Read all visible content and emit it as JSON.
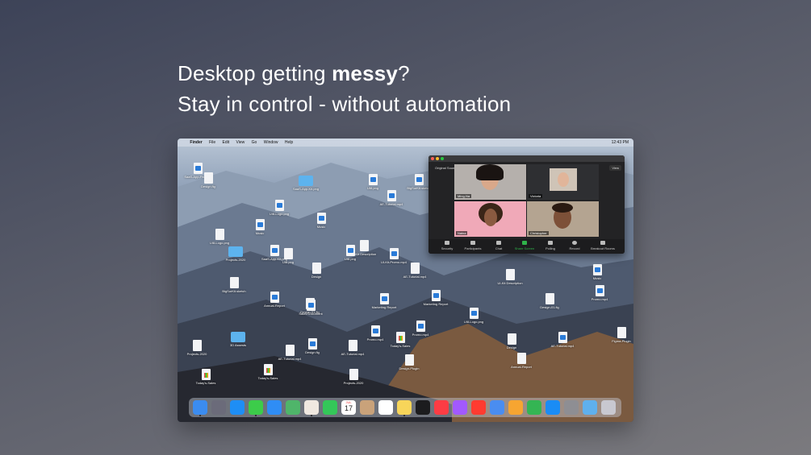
{
  "headline": {
    "line1_prefix": "Desktop getting ",
    "line1_bold": "messy",
    "line1_suffix": "?",
    "line2": "Stay in control - without automation"
  },
  "menubar": {
    "apple": "",
    "app": "Finder",
    "items": [
      "File",
      "Edit",
      "View",
      "Go",
      "Window",
      "Help"
    ],
    "clock": "12:43 PM"
  },
  "desktop_files": [
    {
      "label": "SaaS-App-Feature",
      "kind": "doc-blue"
    },
    {
      "label": "Design.fig",
      "kind": "doc"
    },
    {
      "label": "SaaS-App-Kit.png",
      "kind": "folder"
    },
    {
      "label": "UI8.png",
      "kind": "doc-blue"
    },
    {
      "label": "AE-Tutorial.mp4",
      "kind": "doc-blue"
    },
    {
      "label": "BigSurKit.sketch",
      "kind": "doc-blue"
    },
    {
      "label": "UI8-Logo.png",
      "kind": "doc-blue"
    },
    {
      "label": "Music",
      "kind": "doc-blue"
    },
    {
      "label": "Music",
      "kind": "doc-blue"
    },
    {
      "label": "UI8-Logo.png",
      "kind": "doc"
    },
    {
      "label": "Projects-2020",
      "kind": "folder"
    },
    {
      "label": "SaaS-App-Kit.png",
      "kind": "doc-blue"
    },
    {
      "label": "UI8.png",
      "kind": "doc"
    },
    {
      "label": "Lt-Kit Description",
      "kind": "doc"
    },
    {
      "label": "UI8.png",
      "kind": "doc-blue"
    },
    {
      "label": "UI-Kit-Promo.mp4",
      "kind": "doc-blue"
    },
    {
      "label": "Design",
      "kind": "doc"
    },
    {
      "label": "AE-Tutorial.mp4",
      "kind": "doc"
    },
    {
      "label": "UI-Kit Description",
      "kind": "doc"
    },
    {
      "label": "Music",
      "kind": "doc-blue"
    },
    {
      "label": "BigSurKit.sketch",
      "kind": "doc"
    },
    {
      "label": "Annual-Report",
      "kind": "doc-blue"
    },
    {
      "label": "Design-01.fig",
      "kind": "doc"
    },
    {
      "label": "Sales Document",
      "kind": "doc-blue"
    },
    {
      "label": "Marketing Report",
      "kind": "doc-blue"
    },
    {
      "label": "Marketing Report",
      "kind": "doc-blue"
    },
    {
      "label": "Design-01.fig",
      "kind": "doc"
    },
    {
      "label": "Promo.mp4",
      "kind": "doc-blue"
    },
    {
      "label": "UI8-Logo.png",
      "kind": "doc-blue"
    },
    {
      "label": "Promo.mp4",
      "kind": "doc-blue"
    },
    {
      "label": "Promo.mp4",
      "kind": "doc-blue"
    },
    {
      "label": "Today's-Sales",
      "kind": "doc-chart"
    },
    {
      "label": "Design",
      "kind": "doc"
    },
    {
      "label": "Figma-Plugin",
      "kind": "doc"
    },
    {
      "label": "Projects-2020",
      "kind": "doc"
    },
    {
      "label": "3D Assests",
      "kind": "folder"
    },
    {
      "label": "AE-Tutorial.mp4",
      "kind": "doc"
    },
    {
      "label": "Design.fig",
      "kind": "doc-blue"
    },
    {
      "label": "AE-Tutorial.mp4",
      "kind": "doc"
    },
    {
      "label": "AE-Tutorial.mp4",
      "kind": "doc-blue"
    },
    {
      "label": "Design-Plugin",
      "kind": "doc"
    },
    {
      "label": "Annual-Report",
      "kind": "doc"
    },
    {
      "label": "Today's-Sales",
      "kind": "doc-chart"
    },
    {
      "label": "Today's-Sales",
      "kind": "doc-chart"
    },
    {
      "label": "Projects-2020",
      "kind": "doc"
    }
  ],
  "zoom": {
    "sound": "Original Sound: Off",
    "view": "View",
    "participants": [
      {
        "name": "Ming-Na"
      },
      {
        "name": "Victoria"
      },
      {
        "name": "Naina"
      },
      {
        "name": "Christopher"
      }
    ],
    "controls": [
      "Security",
      "Participants",
      "Chat",
      "Share Screen",
      "Polling",
      "Record",
      "Breakout Rooms"
    ],
    "colors": {
      "share": "#2fb34a",
      "window": "#232325"
    }
  },
  "dock": {
    "calendar_month": "JUL",
    "calendar_day": "17",
    "apps": [
      "finder-icon",
      "launchpad-icon",
      "safari-icon",
      "messages-icon",
      "mail-icon",
      "maps-icon",
      "photos-icon",
      "facetime-icon",
      "calendar-icon",
      "contacts-icon",
      "reminders-icon",
      "notes-icon",
      "tv-icon",
      "music-icon",
      "podcasts-icon",
      "news-icon",
      "keynote-icon",
      "pages-icon",
      "numbers-icon",
      "app-store-icon",
      "system-preferences-icon",
      "folder-icon",
      "trash-icon"
    ]
  }
}
